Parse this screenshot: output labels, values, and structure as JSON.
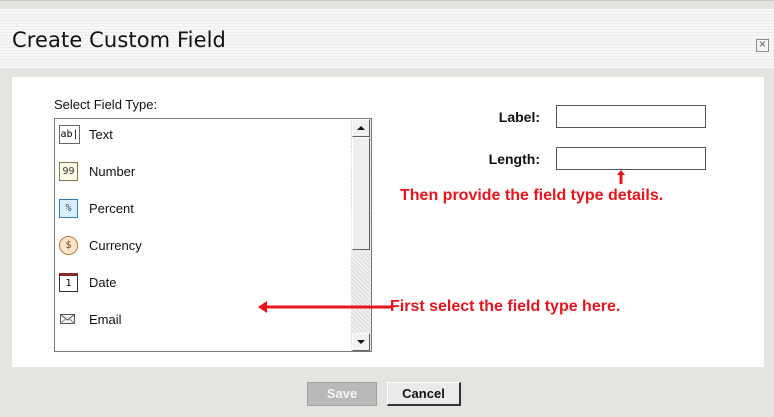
{
  "dialog": {
    "title": "Create Custom Field",
    "close_icon": "close-icon"
  },
  "field_type": {
    "label": "Select Field Type:",
    "items": [
      {
        "label": "Text",
        "icon": "ab|",
        "icon_name": "text-icon"
      },
      {
        "label": "Number",
        "icon": "99",
        "icon_name": "number-icon"
      },
      {
        "label": "Percent",
        "icon": "%",
        "icon_name": "percent-icon"
      },
      {
        "label": "Currency",
        "icon": "$",
        "icon_name": "currency-icon"
      },
      {
        "label": "Date",
        "icon": "1",
        "icon_name": "calendar-icon"
      },
      {
        "label": "Email",
        "icon": "",
        "icon_name": "envelope-icon"
      }
    ]
  },
  "details": {
    "label_label": "Label:",
    "label_value": "",
    "length_label": "Length:",
    "length_value": ""
  },
  "annotations": {
    "details_hint": "Then provide the field type details.",
    "select_hint": "First select the field type here.",
    "color": "#e8141e"
  },
  "footer": {
    "save_label": "Save",
    "cancel_label": "Cancel"
  }
}
